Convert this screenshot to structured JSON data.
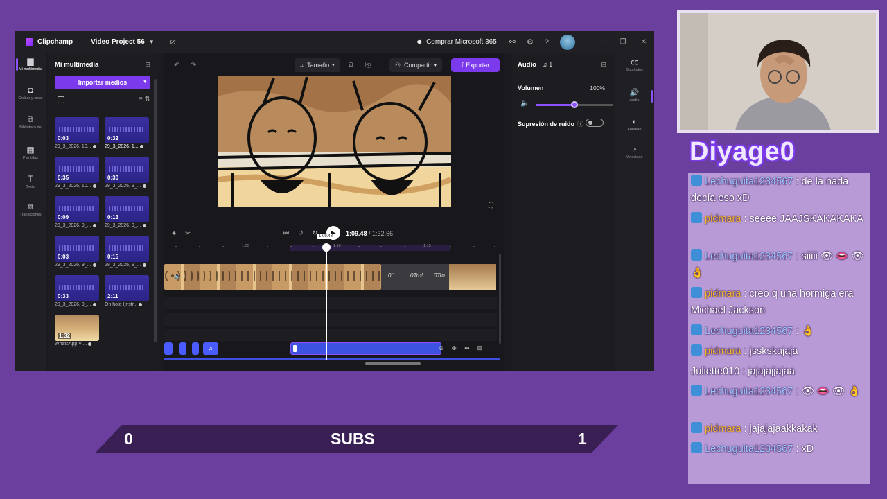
{
  "titlebar": {
    "app_name": "Clipchamp",
    "project_name": "Video Project 56",
    "buy_label": "Comprar Microsoft 365"
  },
  "left_rail": [
    {
      "label": "Mi multimedia"
    },
    {
      "label": "Grabar y crear"
    },
    {
      "label": "Biblioteca de"
    },
    {
      "label": "Plantillas"
    },
    {
      "label": "Texto"
    },
    {
      "label": "Transiciones"
    }
  ],
  "media_panel": {
    "title": "Mi multimedia",
    "import_label": "Importar medios",
    "items": [
      {
        "duration": "0:03",
        "caption": "29_3_2026, 10..."
      },
      {
        "duration": "0:32",
        "caption": "29_3_2026, 1..."
      },
      {
        "duration": "0:35",
        "caption": "29_3_2026, 10..."
      },
      {
        "duration": "0:30",
        "caption": "29_3_2026, 9_..."
      },
      {
        "duration": "0:09",
        "caption": "29_3_2026, 9_..."
      },
      {
        "duration": "0:13",
        "caption": "29_3_2026, 9_..."
      },
      {
        "duration": "0:03",
        "caption": "29_3_2026, 9_..."
      },
      {
        "duration": "0:15",
        "caption": "29_3_2026, 9_..."
      },
      {
        "duration": "0:33",
        "caption": "29_3_2026, 9_..."
      },
      {
        "duration": "2:11",
        "caption": "On hold (instr..."
      },
      {
        "duration": "1:32",
        "caption": "WhatsApp Vi..."
      }
    ]
  },
  "toolbar": {
    "size_label": "Tamaño",
    "share_label": "Compartir",
    "export_label": "Exportar"
  },
  "playback": {
    "current_time": "1:09.48",
    "total_time": "/ 1:32.66",
    "tooltip": "1:09.48"
  },
  "ruler": {
    "ticks": [
      "1:05",
      "1:10",
      "1:15"
    ]
  },
  "timeline": {
    "text_clip_items": [
      "0\"",
      "0Tro!",
      "0Tro"
    ]
  },
  "properties": {
    "tab_audio": "Audio",
    "tab_count": "1",
    "volume_label": "Volumen",
    "volume_value": "100%",
    "volume_fraction": 0.5,
    "noise_label": "Supresión de ruido"
  },
  "right_rail": [
    {
      "label": "Subtítulos"
    },
    {
      "label": "Audio"
    },
    {
      "label": "Fundido"
    },
    {
      "label": "Velocidad"
    }
  ],
  "subs": {
    "left_count": "0",
    "label": "SUBS",
    "right_count": "1"
  },
  "stream": {
    "streamer_name": "Diyage0",
    "chat": [
      {
        "user": "Lechuguita1234567",
        "text": " : de la nada decía eso xD",
        "color": "blue",
        "badge": true
      },
      {
        "user": "pidmara",
        "text": " : seeee JAAJSKAKAKAKA",
        "color": "gold",
        "badge": true
      },
      {
        "user": "Lechuguita1234567",
        "text": " : siiiii 👁 👄 👁 👌",
        "color": "blue",
        "badge": true
      },
      {
        "user": "pidmara",
        "text": " : creo q una hormiga era Michael Jackson",
        "color": "gold",
        "badge": true
      },
      {
        "user": "Lechuguita1234567",
        "text": " : 👌",
        "color": "blue",
        "badge": true
      },
      {
        "user": "pidmara",
        "text": " : jsskskajaja",
        "color": "gold",
        "badge": true
      },
      {
        "user": "Juliette010",
        "text": " : jajajajjajaa",
        "color": "plain",
        "badge": false
      },
      {
        "user": "Lechuguita1234567",
        "text": " : 👁 👄 👁 👌",
        "color": "blue",
        "badge": true
      },
      {
        "user": "pidmara",
        "text": " : jajajajaakkakak",
        "color": "gold",
        "badge": true
      },
      {
        "user": "Lechuguita1234567",
        "text": " : xD",
        "color": "blue",
        "badge": true
      }
    ]
  },
  "colors": {
    "accent": "#7c3aed",
    "background": "#6b3f9e",
    "chat_bg": "#b89ad6"
  }
}
